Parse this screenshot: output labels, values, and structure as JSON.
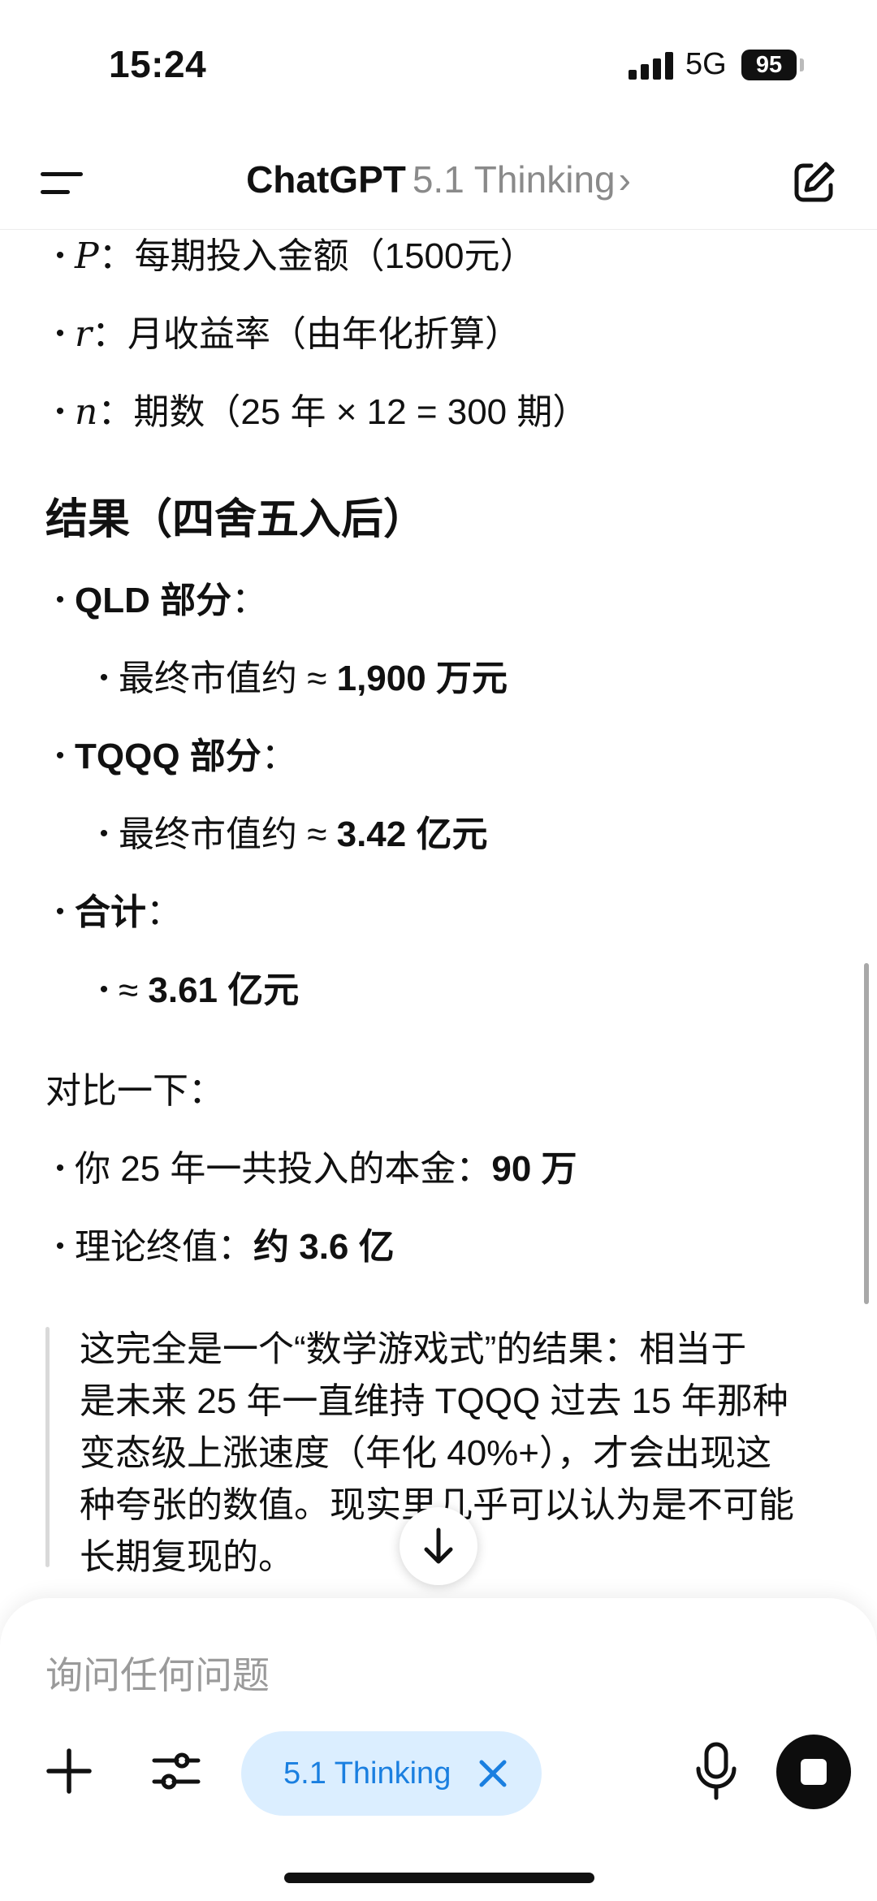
{
  "status_bar": {
    "time": "15:24",
    "network": "5G",
    "battery": "95"
  },
  "nav": {
    "app_name": "ChatGPT",
    "model": "5.1 Thinking",
    "chevron": "›",
    "menu_icon": "hamburger-icon",
    "compose_icon": "compose-icon"
  },
  "message": {
    "var_list": [
      {
        "symbol": "P",
        "text": "每期投入金额（1500元）"
      },
      {
        "symbol": "r",
        "text": "月收益率（由年化折算）"
      },
      {
        "symbol": "n",
        "text": "期数（25 年 × 12 = 300 期）"
      }
    ],
    "results_heading": "结果（四舍五入后）",
    "results": [
      {
        "label": "QLD 部分",
        "colon": "：",
        "sub_prefix": "最终市值约 ≈ ",
        "sub_value": "1,900 万元"
      },
      {
        "label": "TQQQ 部分",
        "colon": "：",
        "sub_prefix": "最终市值约 ≈ ",
        "sub_value": "3.42 亿元"
      },
      {
        "label": "合计",
        "colon": "：",
        "sub_prefix": "≈ ",
        "sub_value": "3.61 亿元"
      }
    ],
    "compare_intro": "对比一下：",
    "compare": [
      {
        "prefix": "你 25 年一共投入的本金：",
        "value": "90 万"
      },
      {
        "prefix": "理论终值：",
        "value": "约 3.6 亿"
      }
    ],
    "quote_lines": [
      "这完全是一个“数学游戏式”的结果：相当于",
      "是未来 25 年一直维持 TQQQ 过去 15 年那种",
      "变态级上涨速度（年化 40%+），才会出现这",
      "种夸张的数值。现实里几乎可以认为是不可能",
      "长期复现的。"
    ]
  },
  "scroll_down_icon": "arrow-down-icon",
  "composer": {
    "placeholder": "询问任何问题",
    "model_chip": "5.1 Thinking",
    "accent_color": "#1a7fe0",
    "chip_bg": "#dbeeff"
  }
}
